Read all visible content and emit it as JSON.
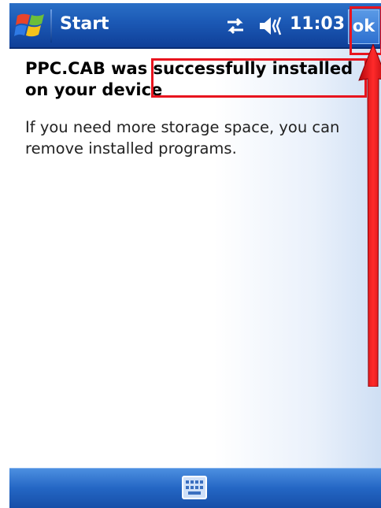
{
  "taskbar": {
    "start_label": "Start",
    "clock": "11:03",
    "ok_label": "ok",
    "icons": {
      "logo": "windows-flag-icon",
      "connectivity": "connectivity-icon",
      "volume": "volume-icon"
    }
  },
  "content": {
    "headline": "PPC.CAB was successfully installed on your device",
    "body": "If you need more storage space, you can remove installed programs."
  },
  "bottombar": {
    "keyboard_icon": "keyboard-icon"
  },
  "colors": {
    "taskbar_blue": "#1b58b4",
    "annotation_red": "#e8141e"
  }
}
